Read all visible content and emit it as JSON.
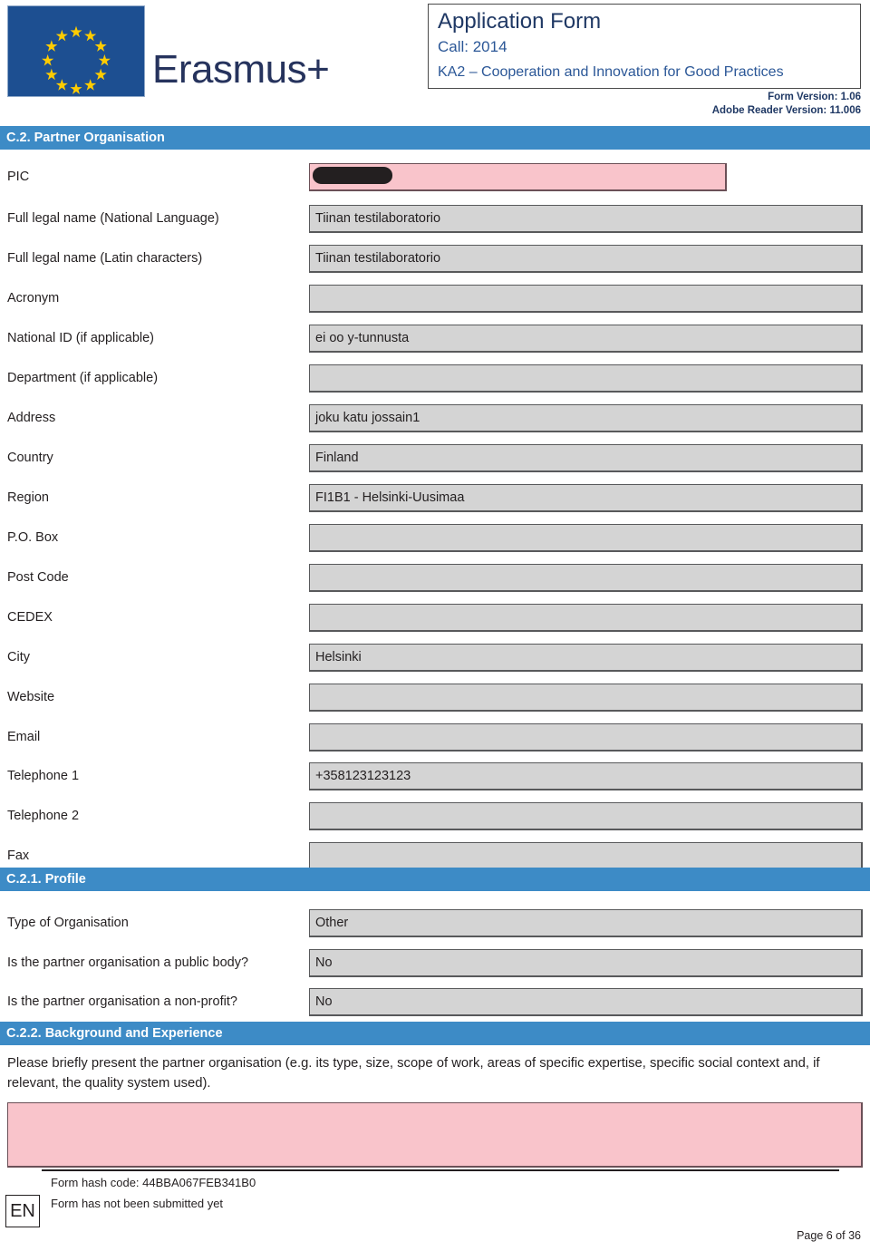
{
  "header": {
    "logo_alt": "European Union flag",
    "brand": "Erasmus+",
    "title": "Application Form",
    "call": "Call: 2014",
    "action": "KA2 – Cooperation and Innovation for Good Practices",
    "form_version": "Form Version: 1.06",
    "reader_version": "Adobe Reader Version: 11.006"
  },
  "colors": {
    "section_bar": "#3d8bc6",
    "field_bg": "#d4d4d4",
    "field_required_bg": "#f9c4cb",
    "flag_blue": "#1d4f91",
    "star_yellow": "#ffcc00",
    "brand_navy": "#26335d"
  },
  "sections": [
    {
      "id": "c2",
      "title": "C.2. Partner Organisation"
    },
    {
      "id": "c21",
      "title": "C.2.1. Profile"
    },
    {
      "id": "c22",
      "title": "C.2.2. Background and Experience"
    }
  ],
  "organisation_fields": [
    {
      "label": "PIC",
      "value": "",
      "style": "pink-redacted"
    },
    {
      "label": "Full legal name (National Language)",
      "value": "Tiinan testilaboratorio",
      "style": "grey"
    },
    {
      "label": "Full legal name (Latin characters)",
      "value": "Tiinan testilaboratorio",
      "style": "grey"
    },
    {
      "label": "Acronym",
      "value": "",
      "style": "grey"
    },
    {
      "label": "National ID (if applicable)",
      "value": "ei oo y-tunnusta",
      "style": "grey"
    },
    {
      "label": "Department (if applicable)",
      "value": "",
      "style": "grey"
    },
    {
      "label": "Address",
      "value": "joku katu jossain1",
      "style": "grey"
    },
    {
      "label": "Country",
      "value": "Finland",
      "style": "grey"
    },
    {
      "label": "Region",
      "value": "FI1B1 - Helsinki-Uusimaa",
      "style": "grey"
    },
    {
      "label": "P.O. Box",
      "value": "",
      "style": "grey"
    },
    {
      "label": "Post Code",
      "value": "",
      "style": "grey"
    },
    {
      "label": "CEDEX",
      "value": "",
      "style": "grey"
    },
    {
      "label": "City",
      "value": "Helsinki",
      "style": "grey"
    },
    {
      "label": "Website",
      "value": "",
      "style": "grey"
    },
    {
      "label": "Email",
      "value": "",
      "style": "grey"
    },
    {
      "label": "Telephone 1",
      "value": "+358123123123",
      "style": "grey"
    },
    {
      "label": "Telephone 2",
      "value": "",
      "style": "grey"
    },
    {
      "label": "Fax",
      "value": "",
      "style": "grey"
    }
  ],
  "profile_fields": [
    {
      "label": "Type of Organisation",
      "value": "Other",
      "style": "grey"
    },
    {
      "label": "Is the partner organisation a public body?",
      "value": "No",
      "style": "grey"
    },
    {
      "label": "Is the partner organisation a non-profit?",
      "value": "No",
      "style": "grey"
    }
  ],
  "background": {
    "question": "Please briefly present the partner organisation (e.g. its type, size, scope of work, areas of specific expertise, specific social context and, if relevant, the quality system used).",
    "answer": ""
  },
  "footer": {
    "language_badge": "EN",
    "hash": "Form hash code: 44BBA067FEB341B0",
    "status": "Form has not been submitted yet",
    "page": "Page 6 of 36"
  }
}
